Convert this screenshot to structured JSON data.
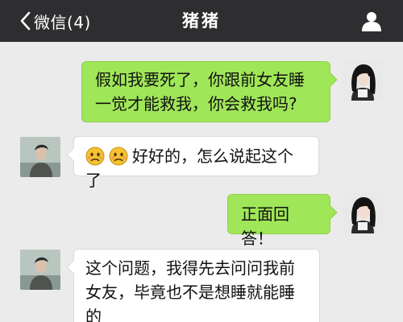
{
  "header": {
    "back_label": "微信(4)",
    "title": "猪猪"
  },
  "messages": [
    {
      "side": "me",
      "text": "假如我要死了，你跟前女友睡一觉才能救我，你会救我吗?"
    },
    {
      "side": "other",
      "emoji": [
        "worried-face",
        "worried-face"
      ],
      "text": "好好的，怎么说起这个了"
    },
    {
      "side": "me",
      "text": "正面回答！"
    },
    {
      "side": "other",
      "text": "这个问题，我得先去问问我前女友，毕竟也不是想睡就能睡的"
    }
  ],
  "colors": {
    "header_bg": "#2e2e30",
    "chat_bg": "#ebebeb",
    "my_bubble": "#9fe658",
    "their_bubble": "#ffffff"
  }
}
